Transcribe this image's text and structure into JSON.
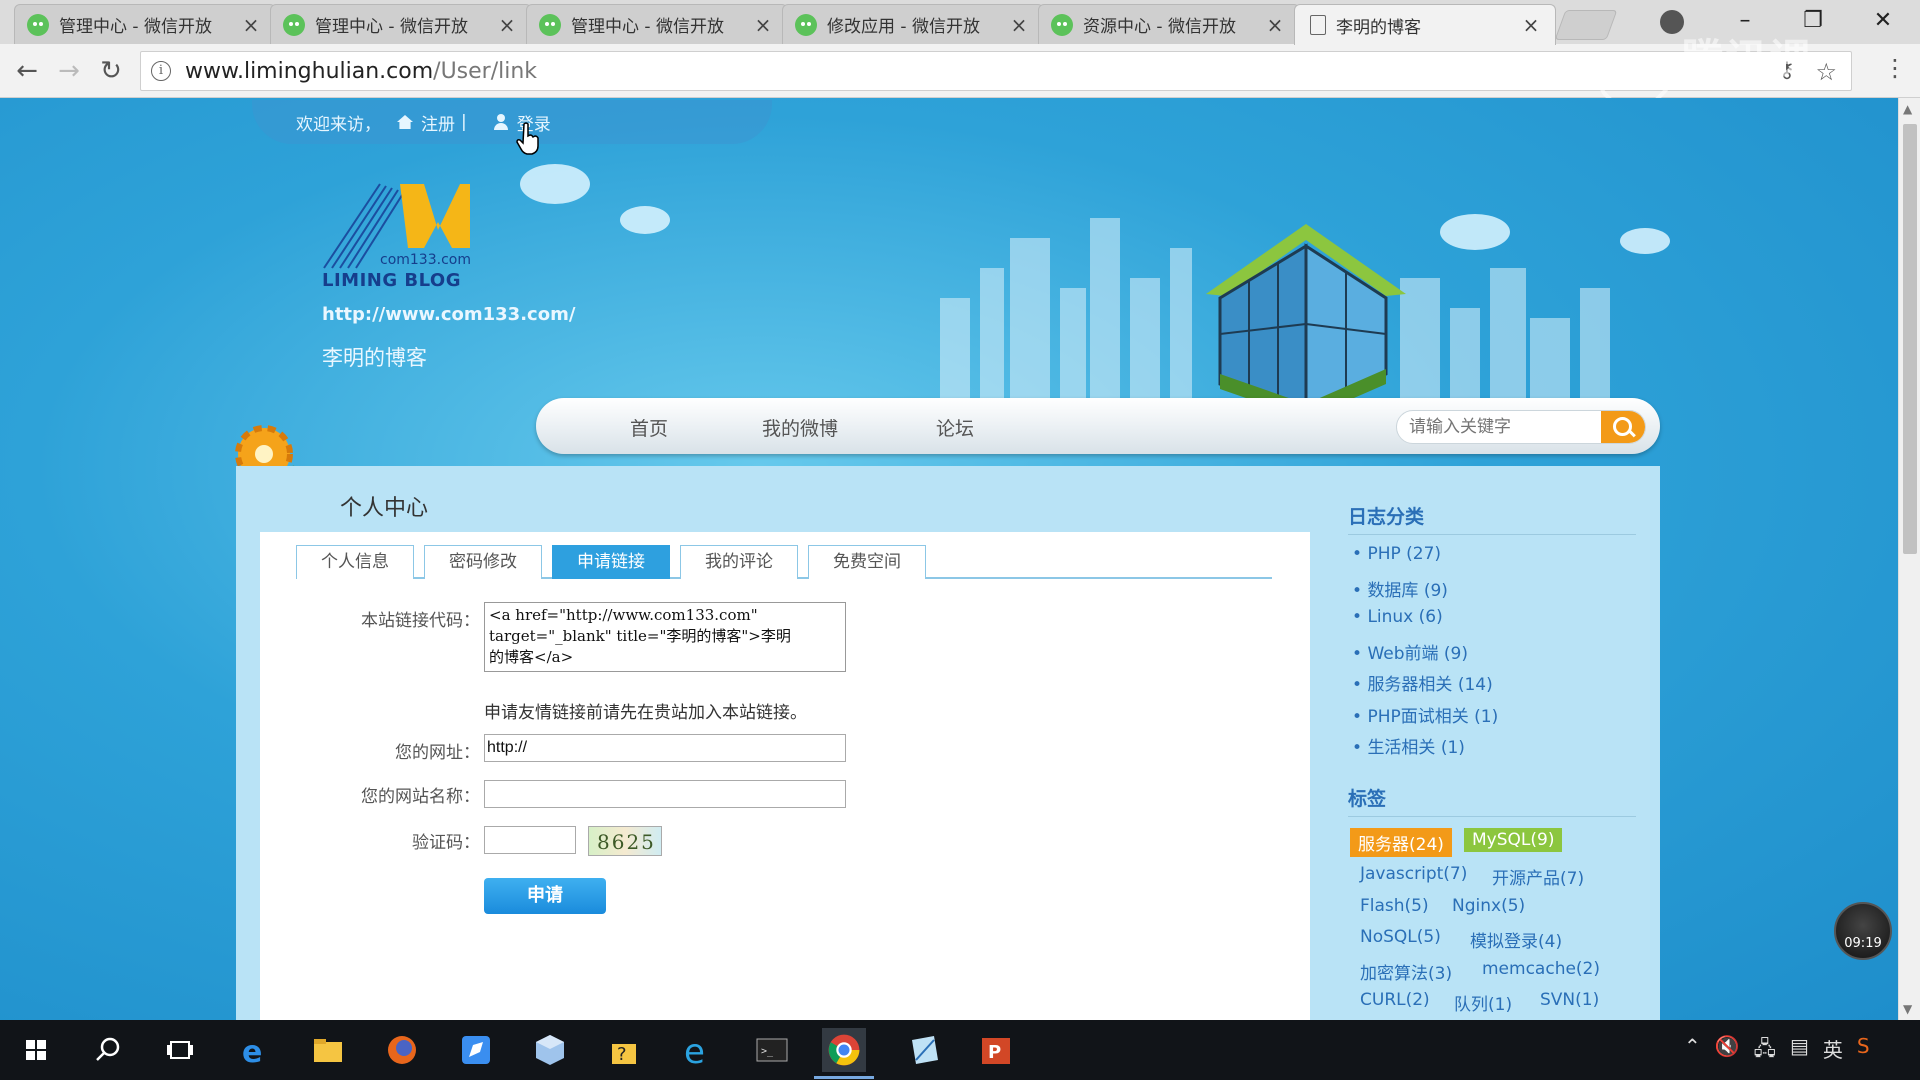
{
  "browser": {
    "tabs": [
      {
        "title": "管理中心 - 微信开放",
        "icon": "wechat-icon"
      },
      {
        "title": "管理中心 - 微信开放",
        "icon": "wechat-icon"
      },
      {
        "title": "管理中心 - 微信开放",
        "icon": "wechat-icon"
      },
      {
        "title": "修改应用 - 微信开放",
        "icon": "wechat-icon"
      },
      {
        "title": "资源中心 - 微信开放",
        "icon": "wechat-icon"
      },
      {
        "title": "李明的博客",
        "icon": "page-icon",
        "active": true
      }
    ],
    "url_host": "www.liminghulian.com",
    "url_path": "/User/link",
    "watermark": "腾讯课堂"
  },
  "header": {
    "welcome": "欢迎来访，",
    "register": "注册",
    "separator": "|",
    "login": "登录",
    "logo_domain": "com133.com",
    "logo_text": "LIMING BLOG",
    "site_url": "http://www.com133.com/",
    "site_name": "李明的博客"
  },
  "nav": {
    "items": [
      "首页",
      "我的微博",
      "论坛"
    ],
    "search_placeholder": "请输入关键字"
  },
  "panel": {
    "title": "个人中心",
    "tabs": [
      "个人信息",
      "密码修改",
      "申请链接",
      "我的评论",
      "免费空间"
    ],
    "active_tab": 2
  },
  "form": {
    "code_label": "本站链接代码：",
    "code_value": "<a href=\"http://www.com133.com\"\ntarget=\"_blank\" title=\"李明的博客\">李明\n的博客</a>",
    "notice": "申请友情链接前请先在贵站加入本站链接。",
    "url_label": "您的网址：",
    "url_value": "http://",
    "sitename_label": "您的网站名称：",
    "sitename_value": "",
    "captcha_label": "验证码：",
    "captcha_value": "",
    "captcha_text": "8625",
    "submit": "申请"
  },
  "sidebar": {
    "categories_title": "日志分类",
    "categories": [
      "PHP (27)",
      "数据库 (9)",
      "Linux (6)",
      "Web前端 (9)",
      "服务器相关 (14)",
      "PHP面试相关 (1)",
      "生活相关 (1)"
    ],
    "tags_title": "标签",
    "tags": [
      {
        "label": "服务器(24)",
        "color": "#f39a18"
      },
      {
        "label": "MySQL(9)",
        "color": "#8cc63f"
      },
      {
        "label": "Javascript(7)"
      },
      {
        "label": "开源产品(7)"
      },
      {
        "label": "Flash(5)"
      },
      {
        "label": "Nginx(5)"
      },
      {
        "label": "NoSQL(5)"
      },
      {
        "label": "模拟登录(4)"
      },
      {
        "label": "加密算法(3)"
      },
      {
        "label": "memcache(2)"
      },
      {
        "label": "CURL(2)"
      },
      {
        "label": "队列(1)"
      },
      {
        "label": "SVN(1)"
      }
    ]
  },
  "overlay": {
    "clock": "09:19"
  },
  "taskbar": {
    "tray_lang": "英"
  }
}
